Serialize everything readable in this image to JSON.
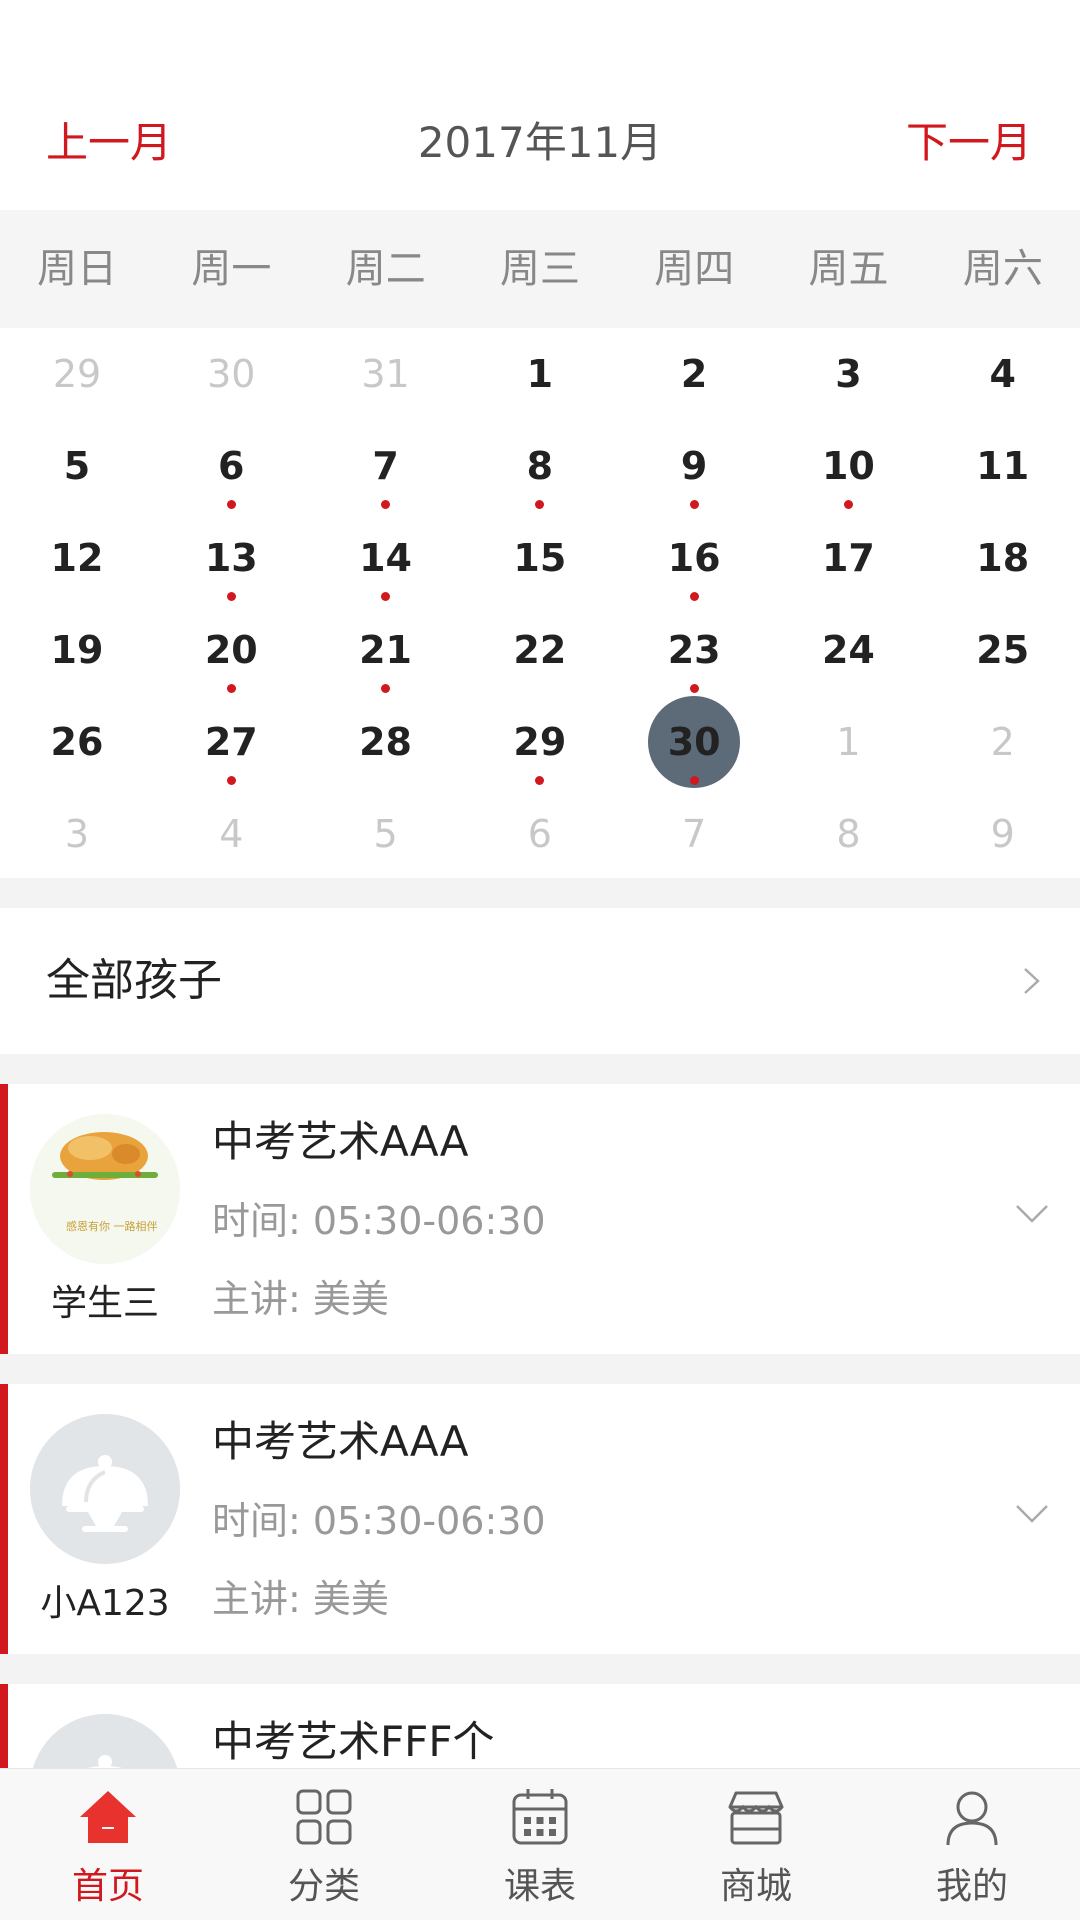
{
  "header": {
    "prev_label": "上一月",
    "title": "2017年11月",
    "next_label": "下一月"
  },
  "weekdays": [
    "周日",
    "周一",
    "周二",
    "周三",
    "周四",
    "周五",
    "周六"
  ],
  "calendar": {
    "weeks": [
      [
        {
          "d": "29",
          "muted": true
        },
        {
          "d": "30",
          "muted": true
        },
        {
          "d": "31",
          "muted": true
        },
        {
          "d": "1"
        },
        {
          "d": "2"
        },
        {
          "d": "3"
        },
        {
          "d": "4"
        }
      ],
      [
        {
          "d": "5"
        },
        {
          "d": "6",
          "dot": true
        },
        {
          "d": "7",
          "dot": true
        },
        {
          "d": "8",
          "dot": true
        },
        {
          "d": "9",
          "dot": true
        },
        {
          "d": "10",
          "dot": true
        },
        {
          "d": "11"
        }
      ],
      [
        {
          "d": "12"
        },
        {
          "d": "13",
          "dot": true
        },
        {
          "d": "14",
          "dot": true
        },
        {
          "d": "15"
        },
        {
          "d": "16",
          "dot": true
        },
        {
          "d": "17"
        },
        {
          "d": "18"
        }
      ],
      [
        {
          "d": "19"
        },
        {
          "d": "20",
          "dot": true
        },
        {
          "d": "21",
          "dot": true
        },
        {
          "d": "22"
        },
        {
          "d": "23",
          "dot": true
        },
        {
          "d": "24"
        },
        {
          "d": "25"
        }
      ],
      [
        {
          "d": "26"
        },
        {
          "d": "27",
          "dot": true
        },
        {
          "d": "28"
        },
        {
          "d": "29",
          "dot": true
        },
        {
          "d": "30",
          "dot": true,
          "selected": true
        },
        {
          "d": "1",
          "muted": true
        },
        {
          "d": "2",
          "muted": true
        }
      ],
      [
        {
          "d": "3",
          "muted": true
        },
        {
          "d": "4",
          "muted": true
        },
        {
          "d": "5",
          "muted": true
        },
        {
          "d": "6",
          "muted": true
        },
        {
          "d": "7",
          "muted": true
        },
        {
          "d": "8",
          "muted": true
        },
        {
          "d": "9",
          "muted": true
        }
      ]
    ]
  },
  "filter": {
    "label": "全部孩子"
  },
  "courses": [
    {
      "title": "中考艺术AAA",
      "time": "时间: 05:30-06:30",
      "teacher": "主讲: 美美",
      "student": "学生三",
      "avatar": "roast-chicken-photo",
      "avatar_caption": "感恩有你 一路相伴"
    },
    {
      "title": "中考艺术AAA",
      "time": "时间: 05:30-06:30",
      "teacher": "主讲: 美美",
      "student": "小A123",
      "avatar": "default-avatar"
    },
    {
      "title": "中考艺术FFF个",
      "time": "",
      "teacher": "",
      "student": "",
      "avatar": "default-avatar"
    }
  ],
  "tabs": [
    {
      "label": "首页",
      "icon": "home-icon",
      "active": true
    },
    {
      "label": "分类",
      "icon": "category-grid-icon"
    },
    {
      "label": "课表",
      "icon": "calendar-icon"
    },
    {
      "label": "商城",
      "icon": "store-icon"
    },
    {
      "label": "我的",
      "icon": "user-icon"
    }
  ],
  "colors": {
    "accent": "#d0181e",
    "selected_day": "#5d6a78",
    "muted_text": "#c8c8c8",
    "section_bg": "#f3f3f3"
  }
}
